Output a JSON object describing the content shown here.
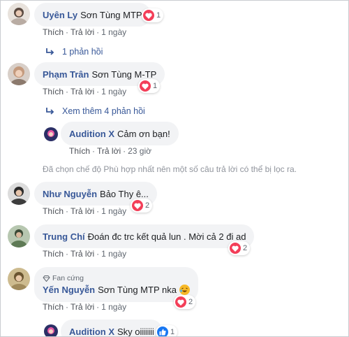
{
  "actions": {
    "like": "Thích",
    "reply": "Trả lời",
    "separator": "·"
  },
  "comments": [
    {
      "name": "Uyên Ly",
      "text": "Sơn Tùng MTP",
      "time": "1 ngày",
      "reaction": "heart",
      "count": "1"
    },
    {
      "name": "Phạm Trân",
      "text": "Sơn Tùng M-TP",
      "time": "1 ngày",
      "reaction": "heart",
      "count": "1"
    },
    {
      "name": "Audition X",
      "text": "Cảm ơn bạn!",
      "time": "23 giờ"
    },
    {
      "name": "Như Nguyễn",
      "text": "Bảo Thy ê...",
      "time": "1 ngày",
      "reaction": "heart",
      "count": "2"
    },
    {
      "name": "Trung Chí",
      "text": "Đoán đc trc kết quả lun . Mời cả 2 đi ad",
      "time": "1 ngày",
      "reaction": "heart",
      "count": "2"
    },
    {
      "badge": "Fan cứng",
      "name": "Yến Nguyễn",
      "text": "Sơn Tùng MTP nka",
      "time": "1 ngày",
      "reaction": "heart",
      "count": "2"
    },
    {
      "name": "Audition X",
      "text": "Sky oiiiiiii",
      "reaction": "like",
      "count": "1"
    }
  ],
  "reply_links": [
    "1 phản hồi",
    "Xem thêm 4 phản hồi"
  ],
  "notice": "Đã chọn chế độ Phù hợp nhất nên một số câu trả lời có thể bị lọc ra.",
  "colors": {
    "name": "#385898",
    "bubble": "#f2f3f5",
    "heart": "#f33e58",
    "like": "#1877f2"
  }
}
